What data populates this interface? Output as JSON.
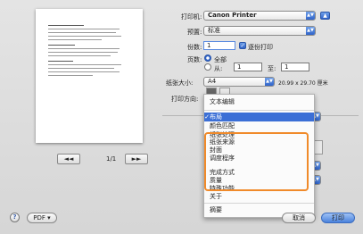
{
  "printer": {
    "label": "打印机:",
    "value": "Canon Printer"
  },
  "presets": {
    "label": "预置:",
    "value": "标准"
  },
  "copies": {
    "label": "份数:",
    "value": "1",
    "collate_label": "逐份打印"
  },
  "pages": {
    "label": "页数:",
    "all_label": "全部",
    "from_label": "从:",
    "from_value": "1",
    "to_label": "至:",
    "to_value": "1"
  },
  "paper": {
    "label": "纸张大小:",
    "value": "A4",
    "dims": "20.99 x 29.70 厘米"
  },
  "orientation": {
    "label": "打印方向:"
  },
  "preview_nav": {
    "page_indicator": "1/1",
    "first": "◄◄",
    "prev": "◄",
    "next": "►",
    "last": "►►"
  },
  "menu": {
    "top_item": "文本编辑",
    "items": [
      "布局",
      "颜色匹配",
      "纸张处理",
      "纸张来源",
      "封面",
      "调度程序",
      "完成方式",
      "质量",
      "特殊功能",
      "关于",
      "摘要"
    ],
    "selected": "布局"
  },
  "bottom": {
    "help": "?",
    "pdf_label": "PDF ▾",
    "cancel_label": "取消",
    "print_label": "打印"
  },
  "colors": {
    "highlight": "#f08a2a",
    "accent": "#3b6fd6"
  }
}
